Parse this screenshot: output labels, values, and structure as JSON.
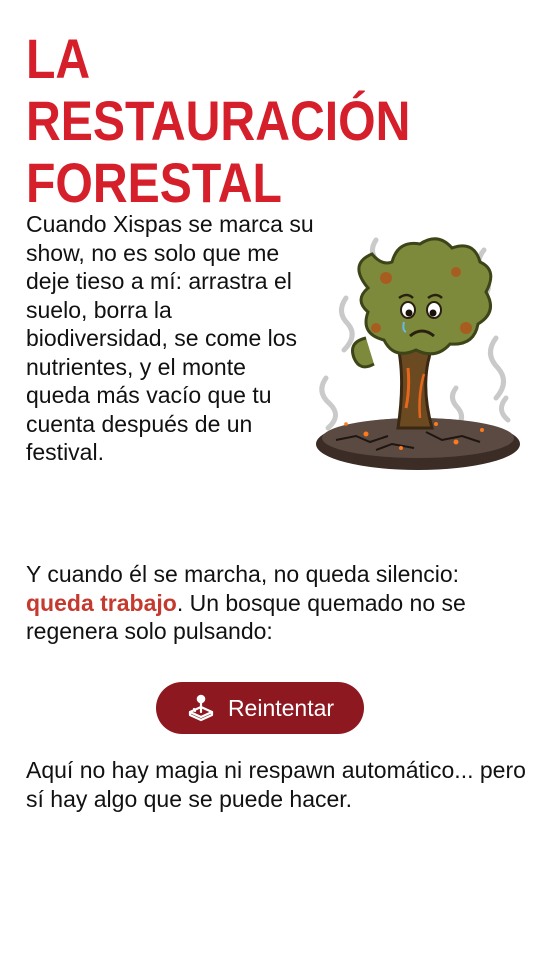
{
  "title_line1": "LA RESTAURACIÓN",
  "title_line2": "FORESTAL",
  "intro_paragraph": "Cuando Xispas se marca su show, no es solo que me deje tieso a mí: arrastra el suelo, borra la biodiversidad, se come los nutrientes, y el monte queda más vacío que tu cuenta después de un festival.",
  "second_paragraph": {
    "before": "Y cuando él se marcha, no queda silencio: ",
    "highlight": "queda trabajo",
    "after": ". Un bosque quemado no se regenera solo pulsando:"
  },
  "retry_button": {
    "label": "Reintentar",
    "icon": "joystick-icon"
  },
  "final_paragraph": "Aquí no hay magia ni respawn automático... pero sí hay algo que se puede hacer.",
  "colors": {
    "title": "#d51f2b",
    "highlight": "#c53a2f",
    "button_bg": "#8e1820",
    "button_text": "#ffffff"
  }
}
